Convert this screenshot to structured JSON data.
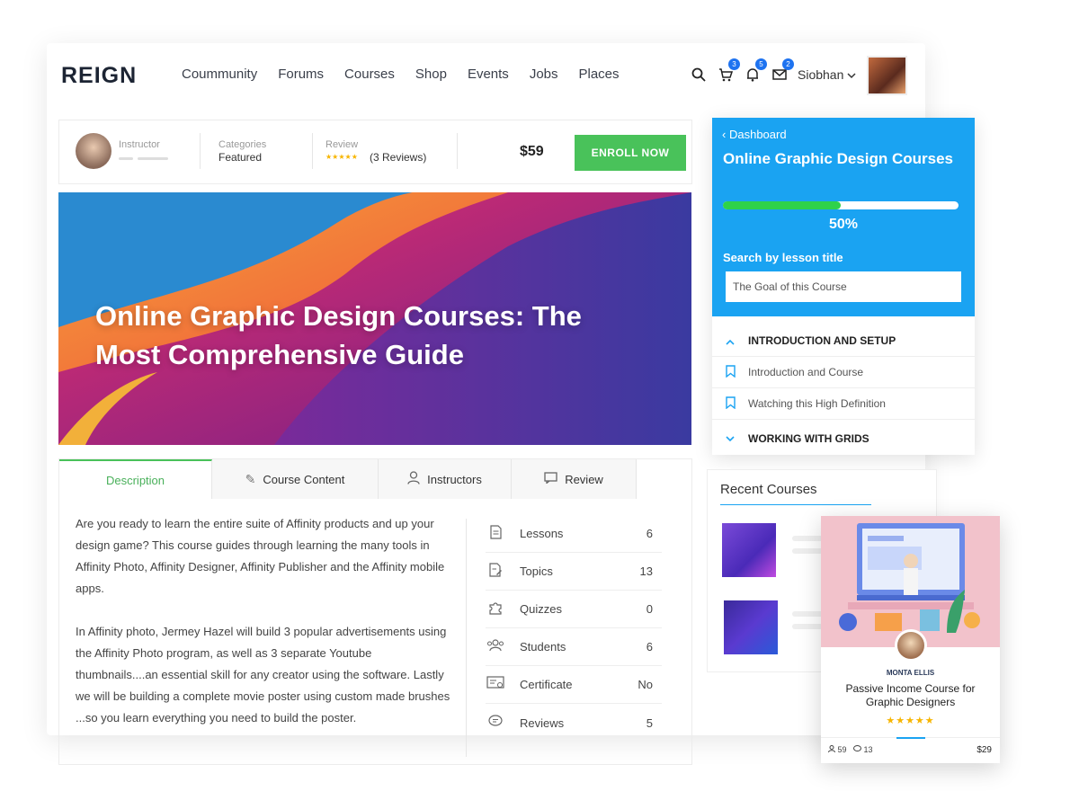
{
  "header": {
    "logo": "REIGN",
    "nav": [
      "Coummunity",
      "Forums",
      "Courses",
      "Shop",
      "Events",
      "Jobs",
      "Places"
    ],
    "cart_count": "3",
    "notifications_count": "5",
    "messages_count": "2",
    "user_name": "Siobhan"
  },
  "meta": {
    "instructor_label": "Instructor",
    "categories_label": "Categories",
    "categories_value": "Featured",
    "review_label": "Review",
    "review_stars": "★★★★★",
    "review_count": "(3 Reviews)",
    "price": "$59",
    "enroll_label": "ENROLL NOW"
  },
  "hero": {
    "title": "Online Graphic Design Courses: The Most Comprehensive Guide"
  },
  "tabs": [
    {
      "label": "Description"
    },
    {
      "label": "Course Content"
    },
    {
      "label": "Instructors"
    },
    {
      "label": "Review"
    }
  ],
  "description": {
    "p1": "Are you ready to learn the entire suite of Affinity products and up your design game? This course guides through learning the many tools in Affinity Photo, Affinity Designer, Affinity Publisher and the Affinity mobile apps.",
    "p2": "In Affinity photo, Jermey Hazel will build 3 popular advertisements using the Affinity Photo program, as well as 3 separate Youtube thumbnails....an essential skill for any creator using the software. Lastly we will be building a complete movie poster using custom made brushes ...so you learn everything you need to build the poster."
  },
  "stats": [
    {
      "label": "Lessons",
      "value": "6"
    },
    {
      "label": "Topics",
      "value": "13"
    },
    {
      "label": "Quizzes",
      "value": "0"
    },
    {
      "label": "Students",
      "value": "6"
    },
    {
      "label": "Certificate",
      "value": "No"
    },
    {
      "label": "Reviews",
      "value": "5"
    }
  ],
  "panel": {
    "back_label": "Dashboard",
    "title": "Online Graphic Design Courses",
    "progress_percent": 50,
    "progress_label": "50%",
    "search_label": "Search by lesson title",
    "search_value": "The Goal of this Course",
    "sections": [
      {
        "label": "INTRODUCTION AND SETUP"
      },
      {
        "label": "Introduction and Course"
      },
      {
        "label": "Watching this High Definition"
      },
      {
        "label": "WORKING WITH GRIDS"
      }
    ]
  },
  "recent": {
    "title": "Recent Courses"
  },
  "card": {
    "author": "MONTA ELLIS",
    "title": "Passive Income Course for Graphic Designers",
    "stars": "★★★★★",
    "students": "59",
    "comments": "13",
    "price": "$29"
  },
  "colors": {
    "accent_green": "#49c25a",
    "panel_blue": "#1aa3f2",
    "progress_green": "#2fd24a",
    "star_yellow": "#f7b500"
  }
}
